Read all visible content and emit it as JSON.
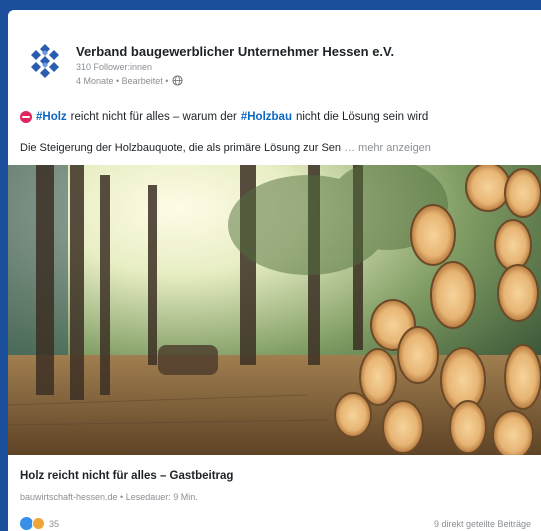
{
  "post": {
    "org_name": "Verband baugewerblicher Unternehmer Hessen e.V.",
    "followers": "310 Follower:innen",
    "meta": "4 Monate • Bearbeitet •",
    "visibility_icon": "globe-icon",
    "headline": {
      "icon": "no-entry-icon",
      "hashtag1": "#Holz",
      "text1": "reicht nicht für alles – warum der",
      "hashtag2": "#Holzbau",
      "text2": "nicht die Lösung sein wird"
    },
    "body": "Die Steigerung der Holzbauquote, die als primäre Lösung zur Sen",
    "more_label": "… mehr anzeigen",
    "image_description_icon": "forest-logs-image",
    "link": {
      "title": "Holz reicht nicht für alles – Gastbeitrag",
      "meta": "bauwirtschaft-hessen.de • Lesedauer: 9 Min."
    },
    "reactions": {
      "count": "35",
      "icons": [
        "like-icon",
        "love-icon"
      ]
    },
    "shares": "9 direkt geteilte Beiträge"
  },
  "colors": {
    "background": "#1b4f9c",
    "hashtag": "#0a66c2",
    "text": "#1d2226",
    "muted": "#8a8f94"
  }
}
